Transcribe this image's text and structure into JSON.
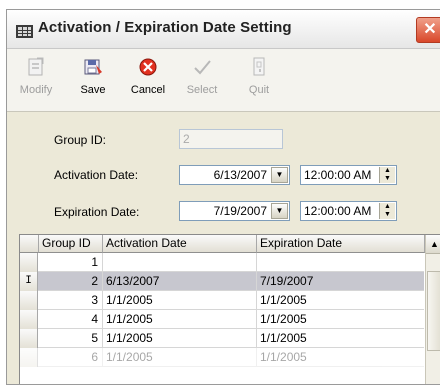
{
  "window": {
    "title": "Activation / Expiration Date Setting",
    "close_label": "✕",
    "icon": "table-window-icon"
  },
  "toolbar": {
    "modify_label": "Modify",
    "save_label": "Save",
    "cancel_label": "Cancel",
    "select_label": "Select",
    "quit_label": "Quit"
  },
  "form": {
    "group_id_label": "Group ID:",
    "group_id_value": "2",
    "activation_label": "Activation Date:",
    "activation_date": "6/13/2007",
    "activation_time": "12:00:00 AM",
    "expiration_label": "Expiration Date:",
    "expiration_date": "7/19/2007",
    "expiration_time": "12:00:00 AM"
  },
  "grid": {
    "columns": [
      "Group ID",
      "Activation Date",
      "Expiration Date"
    ],
    "current_row_marker": "I",
    "rows": [
      {
        "group_id": "1",
        "activation": "",
        "expiration": ""
      },
      {
        "group_id": "2",
        "activation": "6/13/2007",
        "expiration": "7/19/2007"
      },
      {
        "group_id": "3",
        "activation": "1/1/2005",
        "expiration": "1/1/2005"
      },
      {
        "group_id": "4",
        "activation": "1/1/2005",
        "expiration": "1/1/2005"
      },
      {
        "group_id": "5",
        "activation": "1/1/2005",
        "expiration": "1/1/2005"
      },
      {
        "group_id": "6",
        "activation": "1/1/2005",
        "expiration": "1/1/2005"
      }
    ],
    "selected_row": 2
  },
  "colors": {
    "window_bg": "#ece9d8",
    "selected_row": "#c7c7cf",
    "close_red": "#d9472a"
  }
}
